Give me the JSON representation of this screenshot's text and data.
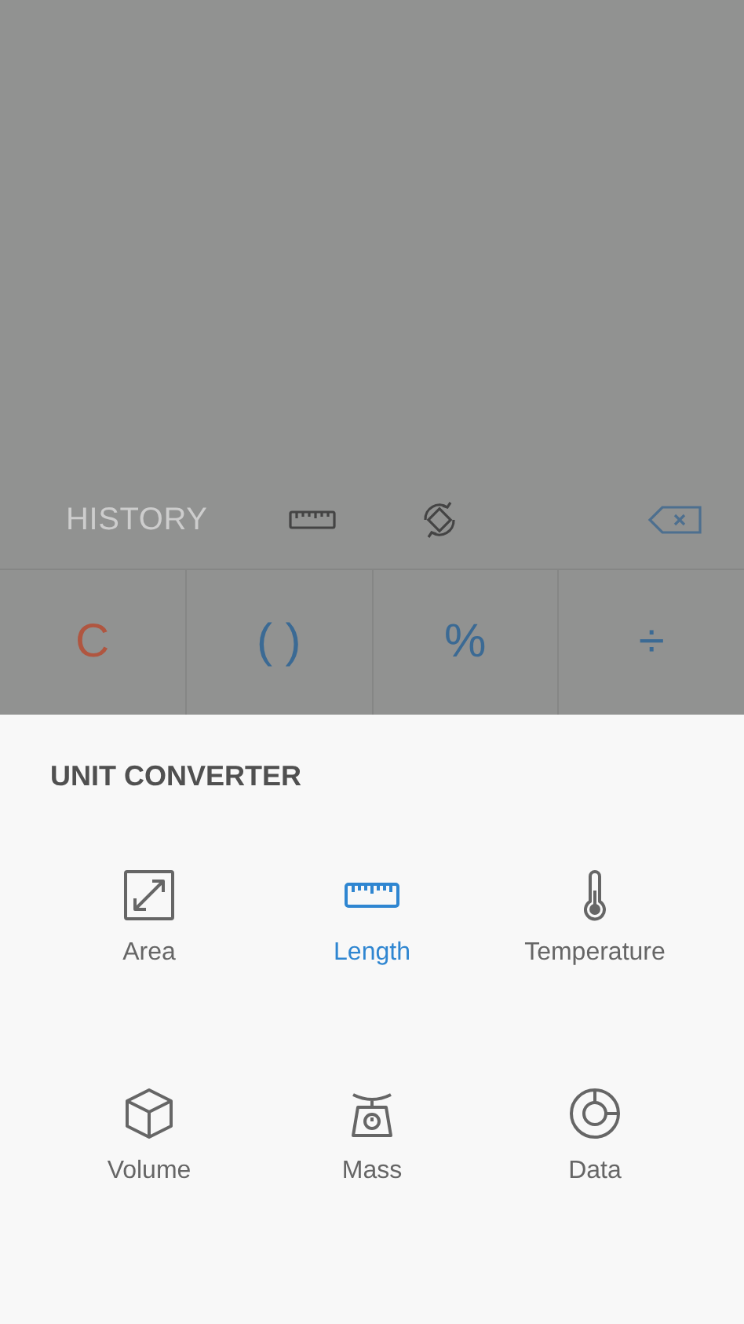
{
  "toolbar": {
    "history_label": "HISTORY"
  },
  "keys": [
    {
      "label": "C",
      "kind": "clear"
    },
    {
      "label": "( )",
      "kind": "operator"
    },
    {
      "label": "%",
      "kind": "operator"
    },
    {
      "label": "÷",
      "kind": "operator"
    }
  ],
  "sheet": {
    "title": "UNIT CONVERTER",
    "units": [
      {
        "label": "Area",
        "kind": "area",
        "selected": false
      },
      {
        "label": "Length",
        "kind": "length",
        "selected": true
      },
      {
        "label": "Temperature",
        "kind": "temperature",
        "selected": false
      },
      {
        "label": "Volume",
        "kind": "volume",
        "selected": false
      },
      {
        "label": "Mass",
        "kind": "mass",
        "selected": false
      },
      {
        "label": "Data",
        "kind": "data",
        "selected": false
      }
    ]
  }
}
